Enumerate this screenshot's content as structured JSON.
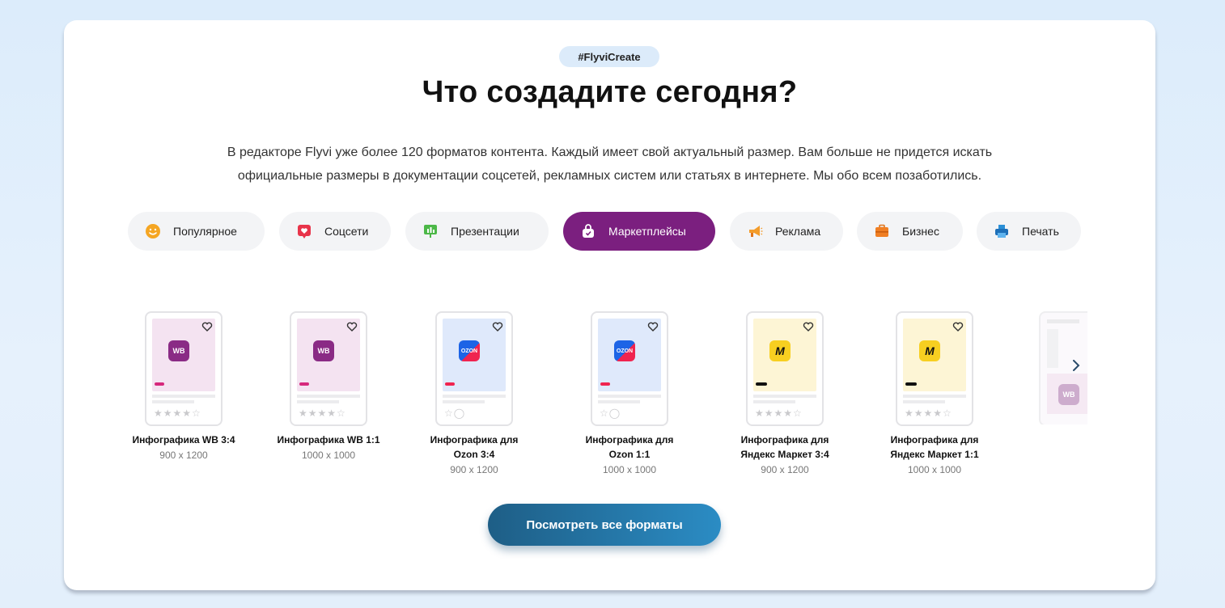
{
  "tag": "#FlyviCreate",
  "title": "Что создадите сегодня?",
  "description": [
    "В редакторе Flyvi уже более 120 форматов контента. Каждый имеет свой актуальный размер. Вам больше не придется искать",
    "официальные размеры в документации соцсетей, рекламных систем или статьях в интернете. Мы обо всем позаботились."
  ],
  "tabs": [
    {
      "label": "Популярное",
      "icon": "smile-icon"
    },
    {
      "label": "Соцсети",
      "icon": "social-heart-icon"
    },
    {
      "label": "Презентации",
      "icon": "presentation-chart-icon"
    },
    {
      "label": "Маркетплейсы",
      "icon": "shopping-bag-icon",
      "active": true
    },
    {
      "label": "Реклама",
      "icon": "megaphone-icon"
    },
    {
      "label": "Бизнес",
      "icon": "briefcase-icon"
    },
    {
      "label": "Печать",
      "icon": "printer-icon"
    }
  ],
  "templates": [
    {
      "name_lines": [
        "Инфографика WB 3:4"
      ],
      "size": "900 x 1200",
      "logo": "WB"
    },
    {
      "name_lines": [
        "Инфографика WB 1:1"
      ],
      "size": "1000 x 1000",
      "logo": "WB"
    },
    {
      "name_lines": [
        "Инфографика для",
        "Ozon 3:4"
      ],
      "size": "900 x 1200",
      "logo": "OZON"
    },
    {
      "name_lines": [
        "Инфографика для",
        "Ozon 1:1"
      ],
      "size": "1000 x 1000",
      "logo": "OZON"
    },
    {
      "name_lines": [
        "Инфографика для",
        "Яндекс Маркет 3:4"
      ],
      "size": "900 x 1200",
      "logo": "M"
    },
    {
      "name_lines": [
        "Инфографика для",
        "Яндекс Маркет 1:1"
      ],
      "size": "1000 x 1000",
      "logo": "M"
    }
  ],
  "partial_template": {
    "logo": "WB"
  },
  "cta_label": "Посмотреть все форматы",
  "colors": {
    "active_tab": "#7b1f7f",
    "wb_bg": "#f4e3f1",
    "wb_logo": "#8a2b85",
    "ozon_bg": "#dfe9fb",
    "ozon_logo": "#1d64e6",
    "ym_bg": "#fdf5d5",
    "ym_logo": "#f7cf21",
    "cta_start": "#1e5e86",
    "cta_end": "#2b8cc4"
  }
}
